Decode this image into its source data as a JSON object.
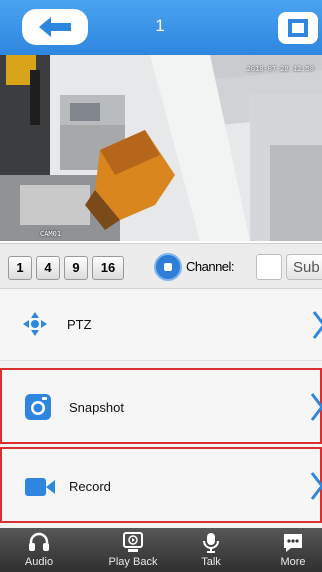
{
  "header": {
    "title": "1",
    "back_icon": "back-arrow-icon",
    "fullscreen_icon": "fullscreen-icon"
  },
  "video": {
    "timestamp": "2018-07-28 12:58",
    "camera_label": "CAM01"
  },
  "layout_bar": {
    "buttons": [
      "1",
      "4",
      "9",
      "16"
    ],
    "channel_label": "Channel:",
    "channel_value": "",
    "stream_label": "Sub"
  },
  "menu": {
    "ptz": {
      "label": "PTZ",
      "icon": "ptz-arrows-icon"
    },
    "snapshot": {
      "label": "Snapshot",
      "icon": "camera-icon"
    },
    "record": {
      "label": "Record",
      "icon": "video-camera-icon"
    }
  },
  "tabs": [
    {
      "label": "Audio",
      "icon": "headphones-icon"
    },
    {
      "label": "Play Back",
      "icon": "playback-icon"
    },
    {
      "label": "Talk",
      "icon": "microphone-icon"
    },
    {
      "label": "More",
      "icon": "more-icon"
    }
  ],
  "colors": {
    "accent_blue": "#2e86df",
    "highlight_red": "#d9302f",
    "bottom_bar": "#3a3a3a"
  }
}
